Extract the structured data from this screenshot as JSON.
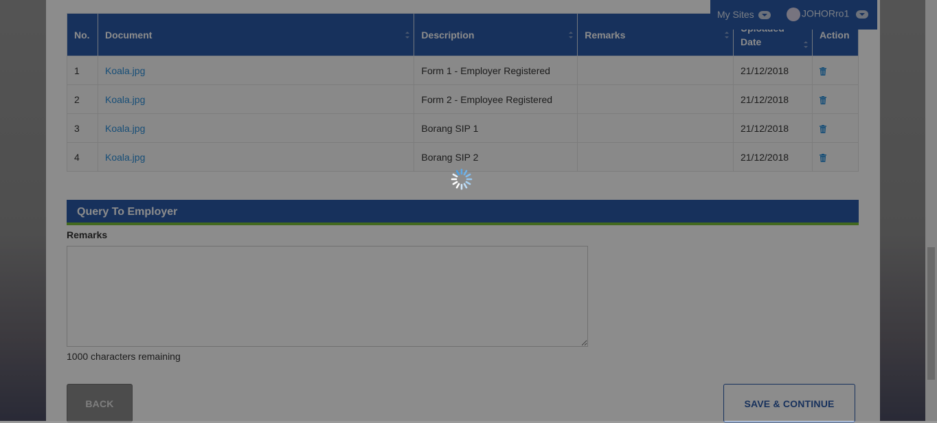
{
  "table": {
    "headers": [
      "No.",
      "Document",
      "Description",
      "Remarks",
      "Uploaded Date",
      "Action"
    ],
    "rows": [
      {
        "no": "1",
        "document": "Koala.jpg",
        "description": "Form 1 - Employer Registered",
        "remarks": "",
        "date": "21/12/2018"
      },
      {
        "no": "2",
        "document": "Koala.jpg",
        "description": "Form 2 - Employee Registered",
        "remarks": "",
        "date": "21/12/2018"
      },
      {
        "no": "3",
        "document": "Koala.jpg",
        "description": "Borang SIP 1",
        "remarks": "",
        "date": "21/12/2018"
      },
      {
        "no": "4",
        "document": "Koala.jpg",
        "description": "Borang SIP 2",
        "remarks": "",
        "date": "21/12/2018"
      }
    ],
    "action_icon": "trash-icon"
  },
  "section": {
    "title": "Query To Employer"
  },
  "form": {
    "remarks_label": "Remarks",
    "remarks_value": "",
    "chars_remaining": "1000 characters remaining"
  },
  "buttons": {
    "back": "BACK",
    "save": "SAVE & CONTINUE"
  },
  "topbar": {
    "my_sites": "My Sites",
    "user": "JOHORro1"
  },
  "colors": {
    "primary": "#2a59a8",
    "accent": "#7bbf3a",
    "link": "#2b8ed9"
  },
  "loading": true
}
